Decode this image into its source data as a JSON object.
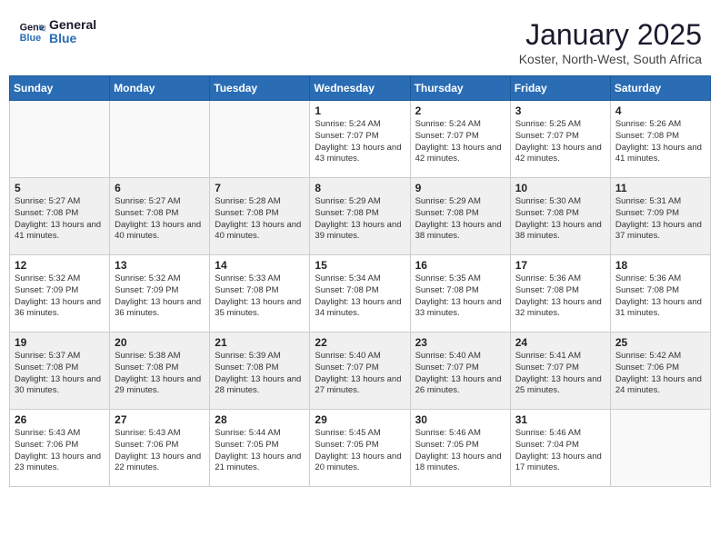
{
  "header": {
    "logo_line1": "General",
    "logo_line2": "Blue",
    "month_year": "January 2025",
    "location": "Koster, North-West, South Africa"
  },
  "weekdays": [
    "Sunday",
    "Monday",
    "Tuesday",
    "Wednesday",
    "Thursday",
    "Friday",
    "Saturday"
  ],
  "weeks": [
    [
      {
        "day": "",
        "info": ""
      },
      {
        "day": "",
        "info": ""
      },
      {
        "day": "",
        "info": ""
      },
      {
        "day": "1",
        "info": "Sunrise: 5:24 AM\nSunset: 7:07 PM\nDaylight: 13 hours\nand 43 minutes."
      },
      {
        "day": "2",
        "info": "Sunrise: 5:24 AM\nSunset: 7:07 PM\nDaylight: 13 hours\nand 42 minutes."
      },
      {
        "day": "3",
        "info": "Sunrise: 5:25 AM\nSunset: 7:07 PM\nDaylight: 13 hours\nand 42 minutes."
      },
      {
        "day": "4",
        "info": "Sunrise: 5:26 AM\nSunset: 7:08 PM\nDaylight: 13 hours\nand 41 minutes."
      }
    ],
    [
      {
        "day": "5",
        "info": "Sunrise: 5:27 AM\nSunset: 7:08 PM\nDaylight: 13 hours\nand 41 minutes."
      },
      {
        "day": "6",
        "info": "Sunrise: 5:27 AM\nSunset: 7:08 PM\nDaylight: 13 hours\nand 40 minutes."
      },
      {
        "day": "7",
        "info": "Sunrise: 5:28 AM\nSunset: 7:08 PM\nDaylight: 13 hours\nand 40 minutes."
      },
      {
        "day": "8",
        "info": "Sunrise: 5:29 AM\nSunset: 7:08 PM\nDaylight: 13 hours\nand 39 minutes."
      },
      {
        "day": "9",
        "info": "Sunrise: 5:29 AM\nSunset: 7:08 PM\nDaylight: 13 hours\nand 38 minutes."
      },
      {
        "day": "10",
        "info": "Sunrise: 5:30 AM\nSunset: 7:08 PM\nDaylight: 13 hours\nand 38 minutes."
      },
      {
        "day": "11",
        "info": "Sunrise: 5:31 AM\nSunset: 7:09 PM\nDaylight: 13 hours\nand 37 minutes."
      }
    ],
    [
      {
        "day": "12",
        "info": "Sunrise: 5:32 AM\nSunset: 7:09 PM\nDaylight: 13 hours\nand 36 minutes."
      },
      {
        "day": "13",
        "info": "Sunrise: 5:32 AM\nSunset: 7:09 PM\nDaylight: 13 hours\nand 36 minutes."
      },
      {
        "day": "14",
        "info": "Sunrise: 5:33 AM\nSunset: 7:08 PM\nDaylight: 13 hours\nand 35 minutes."
      },
      {
        "day": "15",
        "info": "Sunrise: 5:34 AM\nSunset: 7:08 PM\nDaylight: 13 hours\nand 34 minutes."
      },
      {
        "day": "16",
        "info": "Sunrise: 5:35 AM\nSunset: 7:08 PM\nDaylight: 13 hours\nand 33 minutes."
      },
      {
        "day": "17",
        "info": "Sunrise: 5:36 AM\nSunset: 7:08 PM\nDaylight: 13 hours\nand 32 minutes."
      },
      {
        "day": "18",
        "info": "Sunrise: 5:36 AM\nSunset: 7:08 PM\nDaylight: 13 hours\nand 31 minutes."
      }
    ],
    [
      {
        "day": "19",
        "info": "Sunrise: 5:37 AM\nSunset: 7:08 PM\nDaylight: 13 hours\nand 30 minutes."
      },
      {
        "day": "20",
        "info": "Sunrise: 5:38 AM\nSunset: 7:08 PM\nDaylight: 13 hours\nand 29 minutes."
      },
      {
        "day": "21",
        "info": "Sunrise: 5:39 AM\nSunset: 7:08 PM\nDaylight: 13 hours\nand 28 minutes."
      },
      {
        "day": "22",
        "info": "Sunrise: 5:40 AM\nSunset: 7:07 PM\nDaylight: 13 hours\nand 27 minutes."
      },
      {
        "day": "23",
        "info": "Sunrise: 5:40 AM\nSunset: 7:07 PM\nDaylight: 13 hours\nand 26 minutes."
      },
      {
        "day": "24",
        "info": "Sunrise: 5:41 AM\nSunset: 7:07 PM\nDaylight: 13 hours\nand 25 minutes."
      },
      {
        "day": "25",
        "info": "Sunrise: 5:42 AM\nSunset: 7:06 PM\nDaylight: 13 hours\nand 24 minutes."
      }
    ],
    [
      {
        "day": "26",
        "info": "Sunrise: 5:43 AM\nSunset: 7:06 PM\nDaylight: 13 hours\nand 23 minutes."
      },
      {
        "day": "27",
        "info": "Sunrise: 5:43 AM\nSunset: 7:06 PM\nDaylight: 13 hours\nand 22 minutes."
      },
      {
        "day": "28",
        "info": "Sunrise: 5:44 AM\nSunset: 7:05 PM\nDaylight: 13 hours\nand 21 minutes."
      },
      {
        "day": "29",
        "info": "Sunrise: 5:45 AM\nSunset: 7:05 PM\nDaylight: 13 hours\nand 20 minutes."
      },
      {
        "day": "30",
        "info": "Sunrise: 5:46 AM\nSunset: 7:05 PM\nDaylight: 13 hours\nand 18 minutes."
      },
      {
        "day": "31",
        "info": "Sunrise: 5:46 AM\nSunset: 7:04 PM\nDaylight: 13 hours\nand 17 minutes."
      },
      {
        "day": "",
        "info": ""
      }
    ]
  ]
}
